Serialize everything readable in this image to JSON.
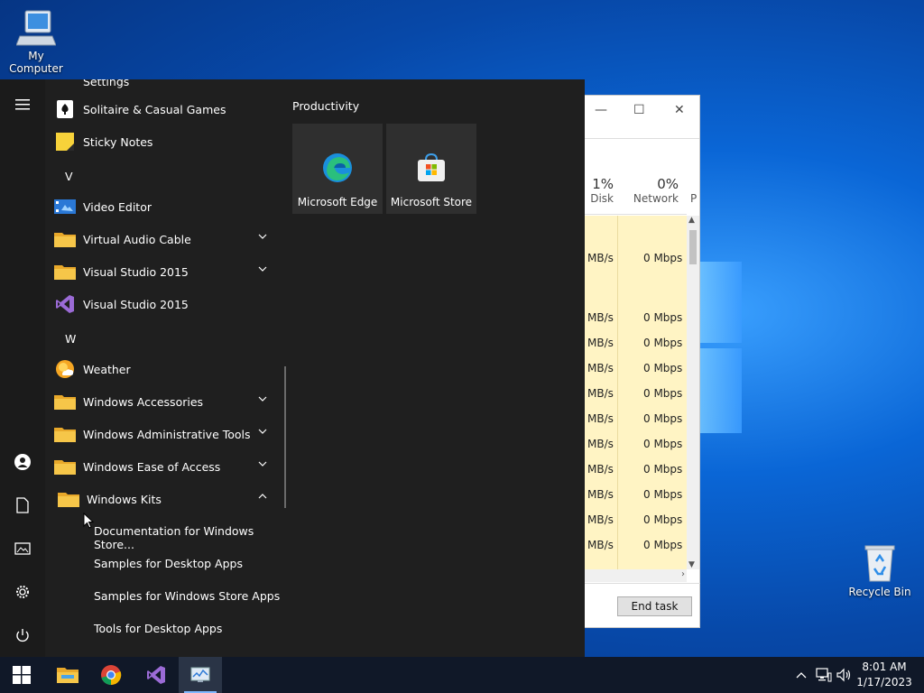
{
  "desktop": {
    "icons": [
      {
        "label": "My Computer"
      },
      {
        "label": "Recycle Bin"
      }
    ]
  },
  "task_manager": {
    "columns": [
      {
        "percent": "1%",
        "label": "Disk"
      },
      {
        "percent": "0%",
        "label": "Network"
      },
      {
        "label": "P"
      }
    ],
    "rows": [
      {
        "disk": "MB/s",
        "network": "0 Mbps"
      },
      {
        "disk": "MB/s",
        "network": "0 Mbps"
      },
      {
        "disk": "MB/s",
        "network": "0 Mbps"
      },
      {
        "disk": "MB/s",
        "network": "0 Mbps"
      },
      {
        "disk": "MB/s",
        "network": "0 Mbps"
      },
      {
        "disk": "MB/s",
        "network": "0 Mbps"
      },
      {
        "disk": "MB/s",
        "network": "0 Mbps"
      },
      {
        "disk": "MB/s",
        "network": "0 Mbps"
      },
      {
        "disk": "MB/s",
        "network": "0 Mbps"
      },
      {
        "disk": "MB/s",
        "network": "0 Mbps"
      },
      {
        "disk": "MB/s",
        "network": "0 Mbps"
      }
    ],
    "end_task_label": "End task"
  },
  "start_menu": {
    "partial_top_item": "Settings",
    "apps": [
      {
        "label": "Solitaire & Casual Games",
        "icon": "cards-icon",
        "expandable": false
      },
      {
        "label": "Sticky Notes",
        "icon": "sticky-note-icon",
        "expandable": false
      },
      {
        "letter": "V"
      },
      {
        "label": "Video Editor",
        "icon": "video-icon",
        "expandable": false
      },
      {
        "label": "Virtual Audio Cable",
        "icon": "folder-icon",
        "expandable": true
      },
      {
        "label": "Visual Studio 2015",
        "icon": "folder-icon",
        "expandable": true
      },
      {
        "label": "Visual Studio 2015",
        "icon": "visual-studio-icon",
        "expandable": false
      },
      {
        "letter": "W"
      },
      {
        "label": "Weather",
        "icon": "weather-icon",
        "expandable": false
      },
      {
        "label": "Windows Accessories",
        "icon": "folder-icon",
        "expandable": true
      },
      {
        "label": "Windows Administrative Tools",
        "icon": "folder-icon",
        "expandable": true
      },
      {
        "label": "Windows Ease of Access",
        "icon": "folder-icon",
        "expandable": true
      },
      {
        "label": "Windows Kits",
        "icon": "folder-icon",
        "expandable": true,
        "expanded": true
      }
    ],
    "sub_items": [
      "Documentation for Windows Store...",
      "Samples for Desktop Apps",
      "Samples for Windows Store Apps",
      "Tools for Desktop Apps"
    ],
    "tiles_group": "Productivity",
    "tiles": [
      {
        "label": "Microsoft Edge",
        "icon": "edge-icon"
      },
      {
        "label": "Microsoft Store",
        "icon": "store-icon"
      }
    ]
  },
  "taskbar": {
    "apps": [
      "start-icon",
      "file-explorer-icon",
      "chrome-icon",
      "visual-studio-icon",
      "task-manager-icon"
    ],
    "clock": {
      "time": "8:01 AM",
      "date": "1/17/2023"
    }
  },
  "colors": {
    "accent": "#0a66d6",
    "start_bg": "#1f1f1f",
    "taskbar_bg": "#101828",
    "row_highlight": "#fff4c4"
  }
}
